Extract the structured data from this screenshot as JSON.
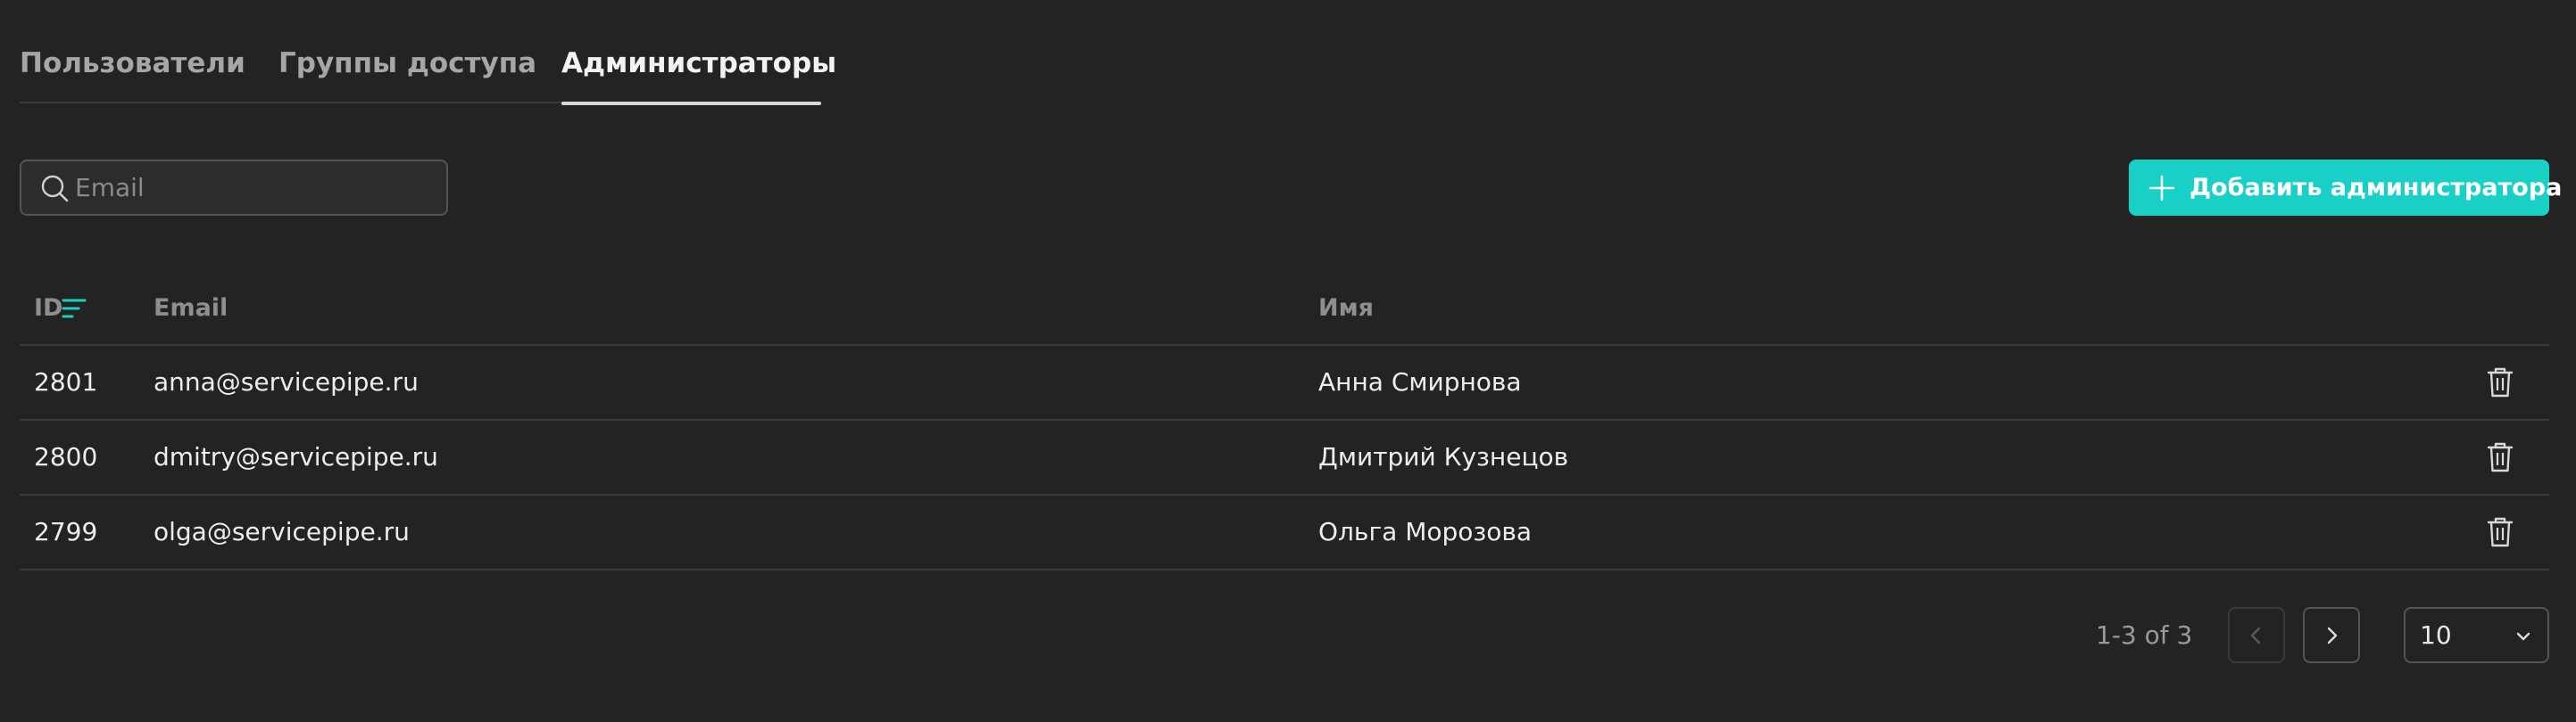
{
  "tabs": [
    {
      "label": "Пользователи",
      "active": false
    },
    {
      "label": "Группы доступа",
      "active": false
    },
    {
      "label": "Администраторы",
      "active": true
    }
  ],
  "search": {
    "placeholder": "Email",
    "value": ""
  },
  "add_button": {
    "label": "Добавить администратора"
  },
  "table": {
    "columns": [
      "ID",
      "Email",
      "Имя"
    ],
    "sort": {
      "column": "ID",
      "icon": "sort-icon"
    },
    "rows": [
      {
        "id": "2801",
        "email": "anna@servicepipe.ru",
        "name": "Анна Смирнова"
      },
      {
        "id": "2800",
        "email": "dmitry@servicepipe.ru",
        "name": "Дмитрий Кузнецов"
      },
      {
        "id": "2799",
        "email": "olga@servicepipe.ru",
        "name": "Ольга Морозова"
      }
    ]
  },
  "pagination": {
    "range": "1-3 of 3",
    "prev_disabled": true,
    "next_disabled": false,
    "per_page": "10"
  },
  "colors": {
    "background": "#232323",
    "accent": "#19d0c7",
    "divider": "#3a3a3a"
  },
  "icons": [
    "search-icon",
    "plus-icon",
    "sort-icon",
    "trash-icon",
    "chevron-left-icon",
    "chevron-right-icon",
    "chevron-down-icon"
  ]
}
